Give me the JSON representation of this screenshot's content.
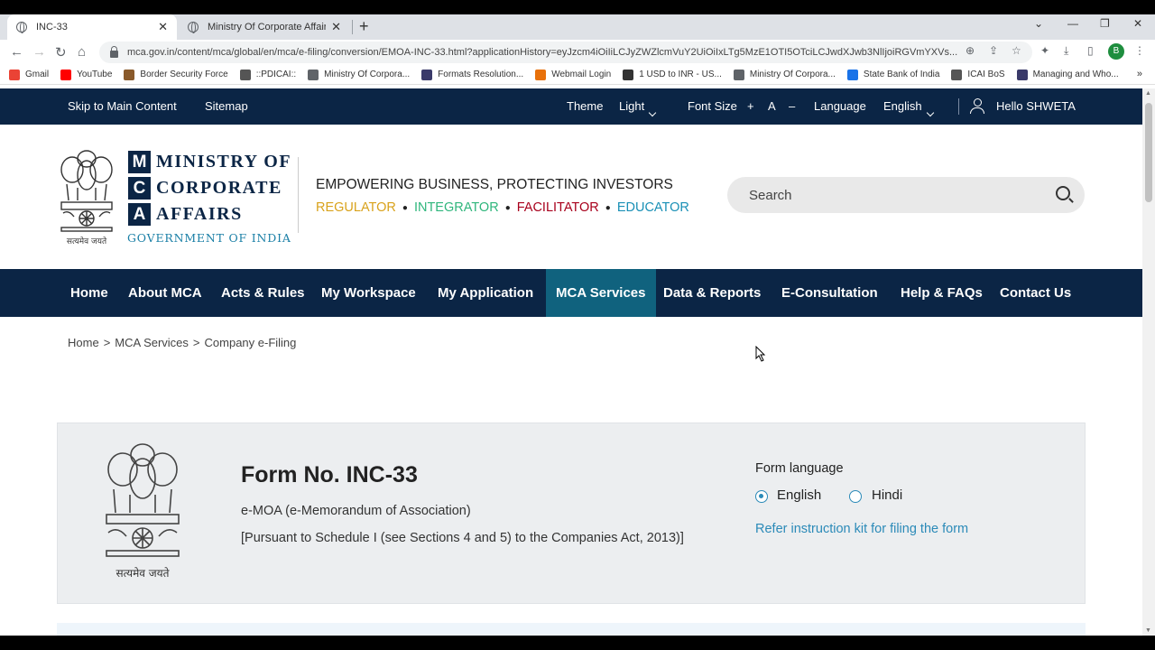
{
  "browser": {
    "tabs": [
      {
        "label": "INC-33",
        "active": true
      },
      {
        "label": "Ministry Of Corporate Affairs - M",
        "active": false
      }
    ],
    "url": "mca.gov.in/content/mca/global/en/mca/e-filing/conversion/EMOA-INC-33.html?applicationHistory=eyJzcm4iOiIiLCJyZWZlcmVuY2UiOiIxLTg5MzE1OTI5OTciLCJwdXJwb3NlIjoiRGVmYXVs...",
    "profile_initial": "B",
    "bookmarks": [
      {
        "label": "Gmail",
        "color": "#ea4335"
      },
      {
        "label": "YouTube",
        "color": "#ff0000"
      },
      {
        "label": "Border Security Force",
        "color": "#8a5a2b"
      },
      {
        "label": "::PDICAI::",
        "color": "#555555"
      },
      {
        "label": "Ministry Of Corpora...",
        "color": "#5f6368"
      },
      {
        "label": "Formats Resolution...",
        "color": "#3a3a6a"
      },
      {
        "label": "Webmail Login",
        "color": "#e8710a"
      },
      {
        "label": "1 USD to INR - US...",
        "color": "#333333"
      },
      {
        "label": "Ministry Of Corpora...",
        "color": "#5f6368"
      },
      {
        "label": "State Bank of India",
        "color": "#1a73e8"
      },
      {
        "label": "ICAI BoS",
        "color": "#555555"
      },
      {
        "label": "Managing and Who...",
        "color": "#3a3a6a"
      }
    ]
  },
  "util": {
    "skip": "Skip to Main Content",
    "sitemap": "Sitemap",
    "theme_label": "Theme",
    "theme_value": "Light",
    "font_label": "Font Size",
    "font_plus": "+",
    "font_a": "A",
    "font_minus": "–",
    "lang_label": "Language",
    "lang_value": "English",
    "greeting": "Hello SHWETA"
  },
  "header": {
    "logo_letters": [
      "M",
      "C",
      "A"
    ],
    "logo_words": [
      "MINISTRY OF",
      "CORPORATE",
      "AFFAIRS"
    ],
    "govt": "GOVERNMENT OF INDIA",
    "emblem_caption": "सत्यमेव जयते",
    "tagline": "EMPOWERING BUSINESS, PROTECTING INVESTORS",
    "roles": [
      {
        "label": "REGULATOR",
        "color": "#d9a21b"
      },
      {
        "label": "INTEGRATOR",
        "color": "#2fb67c"
      },
      {
        "label": "FACILITATOR",
        "color": "#a8001c"
      },
      {
        "label": "EDUCATOR",
        "color": "#1a90b6"
      }
    ],
    "search_placeholder": "Search"
  },
  "nav": {
    "items": [
      "Home",
      "About MCA",
      "Acts & Rules",
      "My Workspace",
      "My Application",
      "MCA Services",
      "Data & Reports",
      "E-Consultation",
      "Help & FAQs",
      "Contact Us"
    ],
    "active": "MCA Services"
  },
  "breadcrumb": [
    "Home",
    "MCA Services",
    "Company e-Filing"
  ],
  "form": {
    "title": "Form No. INC-33",
    "subtitle": "e-MOA (e-Memorandum of Association)",
    "pursuant": "[Pursuant to Schedule I (see Sections 4 and 5) to the Companies Act, 2013)]",
    "lang_label": "Form language",
    "lang_options": [
      "English",
      "Hindi"
    ],
    "lang_selected": "English",
    "kit_link": "Refer instruction kit for filing the form",
    "emblem_caption": "सत्यमेव जयते"
  },
  "colors": {
    "navy": "#0b2545",
    "nav_active": "#10627e",
    "link": "#2b8ab8",
    "card_bg": "#eceef0"
  }
}
